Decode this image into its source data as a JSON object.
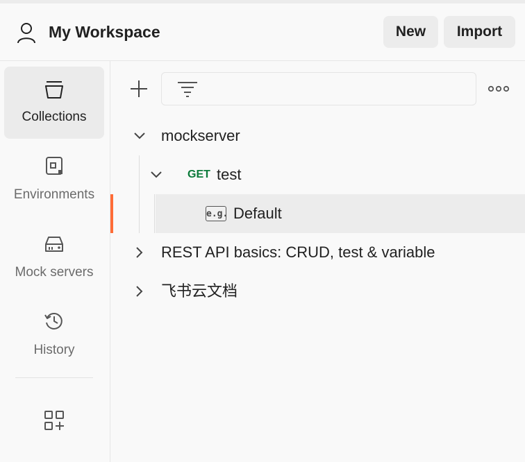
{
  "header": {
    "workspace_title": "My Workspace",
    "new_label": "New",
    "import_label": "Import"
  },
  "sidebar": {
    "items": [
      {
        "label": "Collections",
        "icon": "collections-icon",
        "active": true
      },
      {
        "label": "Environments",
        "icon": "environments-icon",
        "active": false
      },
      {
        "label": "Mock servers",
        "icon": "mock-servers-icon",
        "active": false
      },
      {
        "label": "History",
        "icon": "history-icon",
        "active": false
      }
    ],
    "bottom_icon": "apps-add-icon"
  },
  "toolbar": {
    "add_icon": "plus-icon",
    "filter_icon": "filter-icon",
    "filter_value": "",
    "more_icon": "more-icon"
  },
  "tree": {
    "collections": [
      {
        "name": "mockserver",
        "expanded": true,
        "requests": [
          {
            "method": "GET",
            "name": "test",
            "expanded": true,
            "examples": [
              {
                "badge": "e.g.",
                "name": "Default",
                "selected": true
              }
            ]
          }
        ]
      },
      {
        "name": "REST API basics: CRUD, test & variable",
        "expanded": false
      },
      {
        "name": "飞书云文档",
        "expanded": false
      }
    ]
  },
  "colors": {
    "accent": "#ff6c37",
    "get_method": "#0b7a3a",
    "active_bg": "#ebebeb",
    "background": "#f9f9f9"
  }
}
